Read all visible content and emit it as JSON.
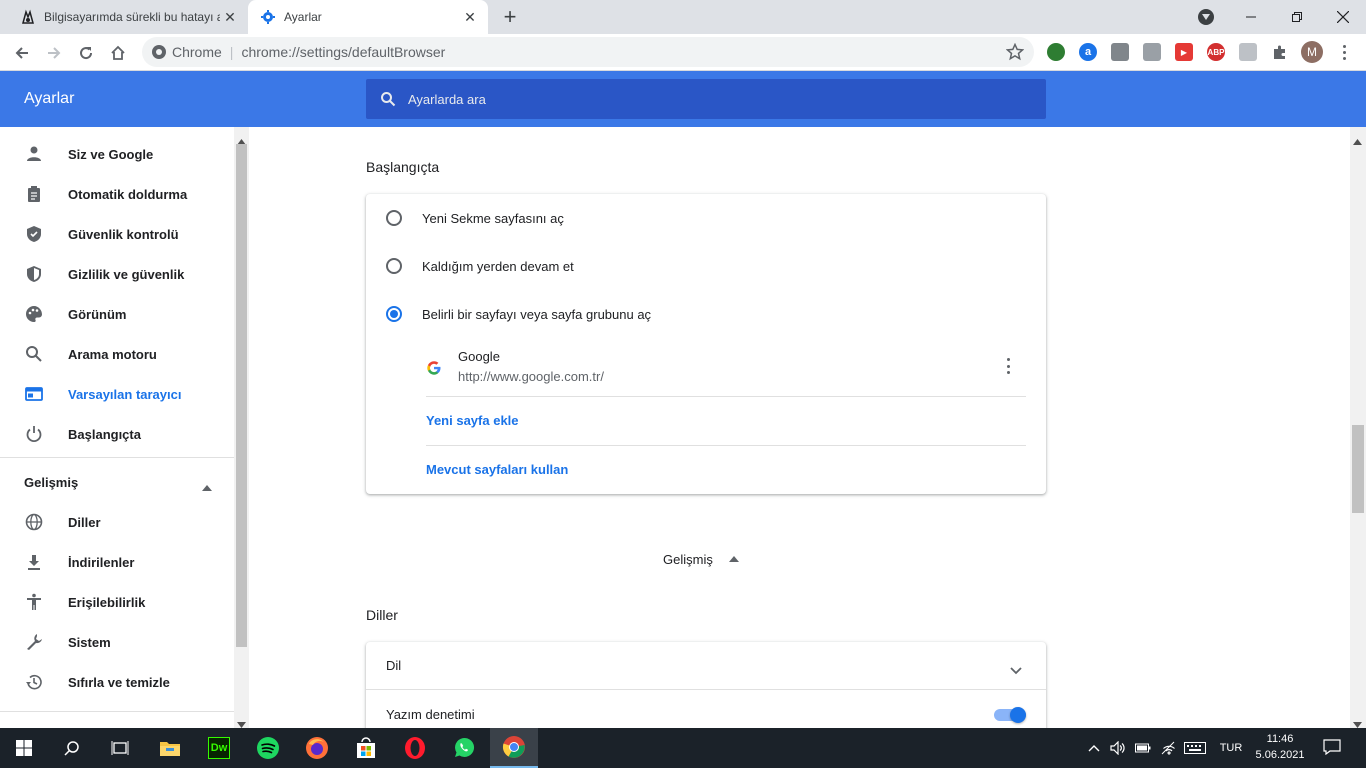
{
  "tabs": [
    {
      "title": "Bilgisayarımda sürekli bu hatayı a",
      "close": "✕"
    },
    {
      "title": "Ayarlar",
      "close": "✕"
    }
  ],
  "new_tab": "+",
  "omnibox": {
    "site": "Chrome",
    "separator": "|",
    "url": "chrome://settings/defaultBrowser"
  },
  "profile_initial": "M",
  "extensions": {
    "abp": "ABP"
  },
  "header": {
    "title": "Ayarlar",
    "search_placeholder": "Ayarlarda ara"
  },
  "sidebar": {
    "items": [
      {
        "label": "Siz ve Google",
        "icon": "person-icon"
      },
      {
        "label": "Otomatik doldurma",
        "icon": "clipboard-icon"
      },
      {
        "label": "Güvenlik kontrolü",
        "icon": "shield-check-icon"
      },
      {
        "label": "Gizlilik ve güvenlik",
        "icon": "shield-icon"
      },
      {
        "label": "Görünüm",
        "icon": "palette-icon"
      },
      {
        "label": "Arama motoru",
        "icon": "search-icon"
      },
      {
        "label": "Varsayılan tarayıcı",
        "icon": "browser-icon",
        "active": true
      },
      {
        "label": "Başlangıçta",
        "icon": "power-icon"
      }
    ],
    "advanced_label": "Gelişmiş",
    "advanced_items": [
      {
        "label": "Diller",
        "icon": "globe-icon"
      },
      {
        "label": "İndirilenler",
        "icon": "download-icon"
      },
      {
        "label": "Erişilebilirlik",
        "icon": "accessibility-icon"
      },
      {
        "label": "Sistem",
        "icon": "wrench-icon"
      },
      {
        "label": "Sıfırla ve temizle",
        "icon": "restore-icon"
      }
    ]
  },
  "startup": {
    "title": "Başlangıçta",
    "options": [
      {
        "label": "Yeni Sekme sayfasını aç",
        "selected": false
      },
      {
        "label": "Kaldığım yerden devam et",
        "selected": false
      },
      {
        "label": "Belirli bir sayfayı veya sayfa grubunu aç",
        "selected": true
      }
    ],
    "page": {
      "name": "Google",
      "url": "http://www.google.com.tr/"
    },
    "add_page": "Yeni sayfa ekle",
    "use_current": "Mevcut sayfaları kullan"
  },
  "advanced_toggle": "Gelişmiş",
  "languages": {
    "title": "Diller",
    "language_label": "Dil",
    "spellcheck_label": "Yazım denetimi",
    "spellcheck_on": true
  },
  "taskbar": {
    "lang": "TUR",
    "time": "11:46",
    "date": "5.06.2021",
    "dw_label": "Dw"
  },
  "colors": {
    "accent": "#1a73e8",
    "header_bg": "#3b78e7",
    "search_bg": "#2a56c6",
    "taskbar_bg": "#1b2229"
  }
}
